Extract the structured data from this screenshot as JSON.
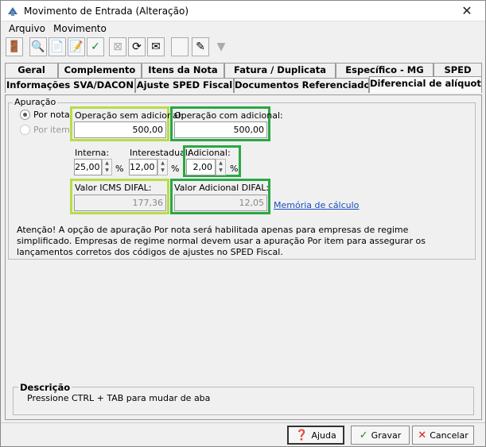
{
  "window": {
    "title": "Movimento de Entrada (Alteração)",
    "close": "✕"
  },
  "menu": {
    "items": [
      "Arquivo",
      "Movimento"
    ]
  },
  "tabs": {
    "row1": [
      "Geral",
      "Complemento",
      "Itens da Nota",
      "Fatura / Duplicata",
      "Específico - MG",
      "SPED"
    ],
    "row2": [
      "Informações SVA/DACON",
      "Ajuste SPED Fiscal",
      "Documentos Referenciados",
      "Diferencial de alíquota"
    ]
  },
  "apuracao": {
    "group_label": "Apuração",
    "radio_por_nota": "Por nota",
    "radio_por_item": "Por item",
    "operacao_sem_adicional_label": "Operação sem adicional:",
    "operacao_sem_adicional_value": "500,00",
    "operacao_com_adicional_label": "Operação com adicional:",
    "operacao_com_adicional_value": "500,00",
    "interna_label": "Interna:",
    "interna_value": "25,00",
    "interestadual_label": "Interestadual:",
    "interestadual_value": "12,00",
    "adicional_label": "Adicional:",
    "adicional_value": "2,00",
    "percent": "%",
    "valor_icms_difal_label": "Valor ICMS DIFAL:",
    "valor_icms_difal_value": "177,36",
    "valor_adicional_difal_label": "Valor Adicional DIFAL:",
    "valor_adicional_difal_value": "12,05",
    "memoria_link": "Memória de cálculo",
    "note": "Atenção! A opção de apuração Por nota será habilitada apenas para empresas de regime simplificado. Empresas de regime normal devem usar a apuração Por item para assegurar os lançamentos corretos dos códigos de ajustes no SPED Fiscal."
  },
  "descricao": {
    "label": "Descrição",
    "text": "Pressione CTRL + TAB para  mudar de aba"
  },
  "buttons": {
    "ajuda": "Ajuda",
    "gravar": "Gravar",
    "cancelar": "Cancelar"
  },
  "colors": {
    "highlight_yellow": "#b8dc4a",
    "highlight_green": "#29a845",
    "link": "#1a4fbf"
  }
}
